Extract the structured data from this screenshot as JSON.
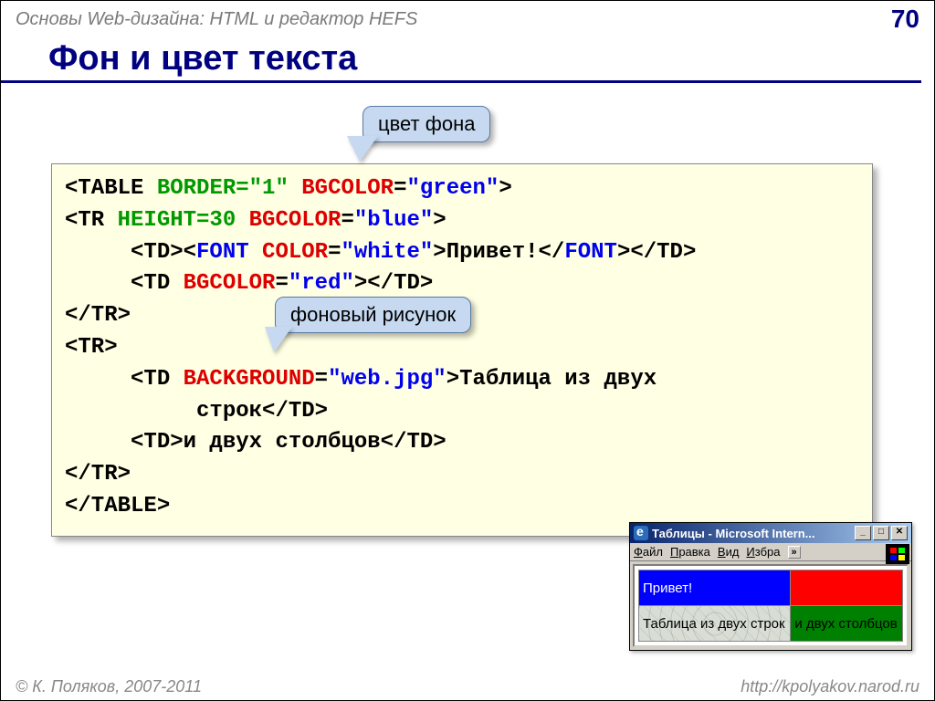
{
  "header": {
    "subject": "Основы Web-дизайна: HTML и редактор HEFS",
    "page_number": "70"
  },
  "title": "Фон и цвет текста",
  "callouts": {
    "bg_color": "цвет фона",
    "bg_image": "фоновый рисунок"
  },
  "code": {
    "l1a": "<TABLE ",
    "l1b": "BORDER=\"1\" ",
    "l1c": "BGCOLOR",
    "l1d": "=",
    "l1e": "\"green\"",
    "l1f": ">",
    "l2a": "<TR ",
    "l2b": "HEIGHT=30 ",
    "l2c": "BGCOLOR",
    "l2d": "=",
    "l2e": "\"blue\"",
    "l2f": ">",
    "indent": "     ",
    "l3a": "<TD><",
    "l3b": "FONT ",
    "l3c": "COLOR",
    "l3d": "=",
    "l3e": "\"white\"",
    "l3f": ">Привет!</",
    "l3g": "FONT",
    "l3h": "></TD>",
    "l4a": "<TD ",
    "l4b": "BGCOLOR",
    "l4c": "=",
    "l4d": "\"red\"",
    "l4e": "></TD>",
    "l5": "</TR>",
    "l6": "<TR>",
    "l7a": "<TD ",
    "l7b": "BACKGROUND",
    "l7c": "=",
    "l7d": "\"web.jpg\"",
    "l7e": ">Таблица из двух",
    "l7cont": "          строк</TD>",
    "l8": "<TD>и двух столбцов</TD>",
    "l9": "</TR>",
    "l10": "</TABLE>"
  },
  "browser": {
    "title": "Таблицы - Microsoft Intern...",
    "menu": {
      "file": "Файл",
      "edit": "Правка",
      "view": "Вид",
      "fav": "Избра"
    },
    "win_min": "_",
    "win_max": "□",
    "win_close": "✕",
    "more": "»",
    "cell1": "Привет!",
    "cell3": "Таблица из двух строк",
    "cell4": "и двух столбцов"
  },
  "footer": {
    "left": "© К. Поляков, 2007-2011",
    "right": "http://kpolyakov.narod.ru"
  }
}
